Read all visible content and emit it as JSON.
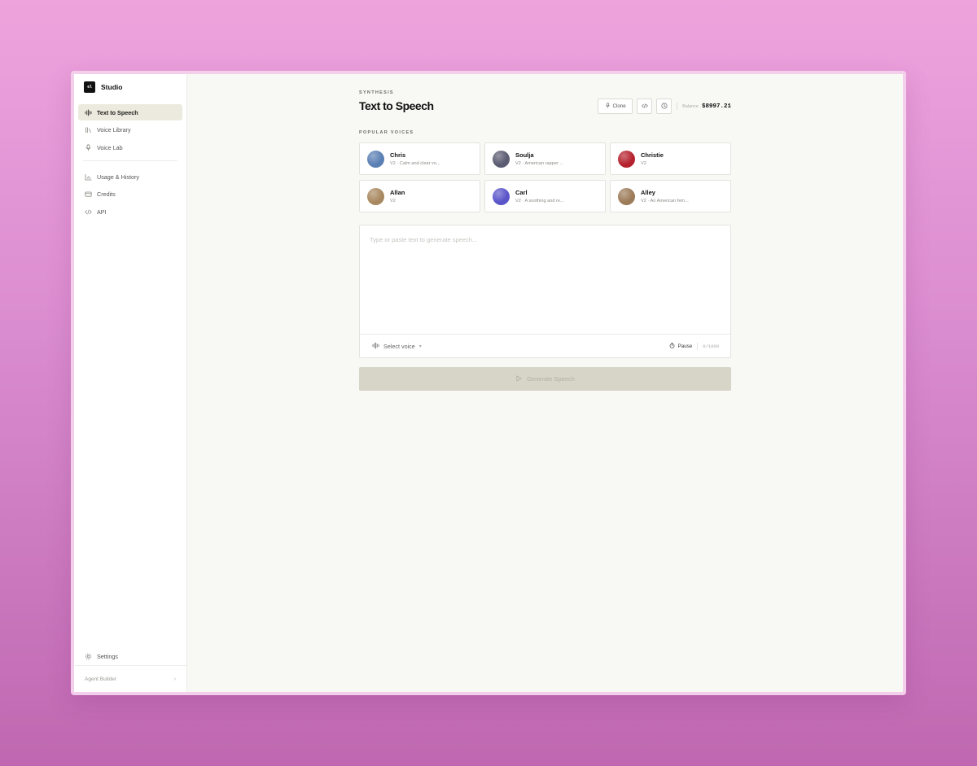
{
  "app": {
    "logo_text": "el",
    "name": "Studio"
  },
  "sidebar": {
    "items": [
      {
        "label": "Text to Speech",
        "icon": "waveform-icon",
        "active": true
      },
      {
        "label": "Voice Library",
        "icon": "library-icon"
      },
      {
        "label": "Voice Lab",
        "icon": "microphone-icon"
      },
      {
        "label": "Usage & History",
        "icon": "bar-chart-icon"
      },
      {
        "label": "Credits",
        "icon": "credit-card-icon"
      },
      {
        "label": "API",
        "icon": "code-icon"
      }
    ],
    "settings_label": "Settings",
    "agent_builder_label": "Agent Builder"
  },
  "header": {
    "eyebrow": "SYNTHESIS",
    "title": "Text to Speech",
    "clone_label": "Clone",
    "balance_label": "Balance",
    "balance_value": "$8997.21"
  },
  "popular_voices": {
    "label": "POPULAR VOICES",
    "voices": [
      {
        "name": "Chris",
        "desc": "V2 · Calm and clear vo...",
        "color": "#5a7fb3"
      },
      {
        "name": "Soulja",
        "desc": "V2 · American rapper ...",
        "color": "#5b5b72"
      },
      {
        "name": "Christie",
        "desc": "V2",
        "color": "#b5222e"
      },
      {
        "name": "Allan",
        "desc": "V2",
        "color": "#a88860"
      },
      {
        "name": "Carl",
        "desc": "V2 · A soothing and re...",
        "color": "#5a55c9"
      },
      {
        "name": "Alley",
        "desc": "V2 · An American fem...",
        "color": "#9c7b58"
      }
    ]
  },
  "editor": {
    "placeholder": "Type or paste text to generate speech...",
    "select_voice_label": "Select voice",
    "pause_label": "Pause",
    "counter": "0/1000"
  },
  "generate_label": "Generate Speech"
}
